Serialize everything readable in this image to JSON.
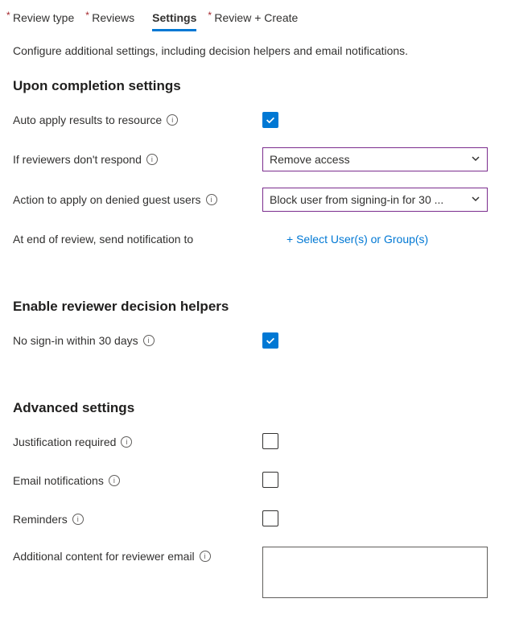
{
  "tabs": {
    "review_type": "Review type",
    "reviews": "Reviews",
    "settings": "Settings",
    "review_create": "Review + Create"
  },
  "intro": "Configure additional settings, including decision helpers and email notifications.",
  "sections": {
    "completion": {
      "title": "Upon completion settings",
      "auto_apply_label": "Auto apply results to resource",
      "no_respond_label": "If reviewers don't respond",
      "no_respond_value": "Remove access",
      "denied_guest_label": "Action to apply on denied guest users",
      "denied_guest_value": "Block user from signing-in for 30 ...",
      "notify_label": "At end of review, send notification to",
      "notify_action": "+ Select User(s) or Group(s)"
    },
    "decision_helpers": {
      "title": "Enable reviewer decision helpers",
      "no_signin_label": "No sign-in within 30 days"
    },
    "advanced": {
      "title": "Advanced settings",
      "justification_label": "Justification required",
      "email_label": "Email notifications",
      "reminders_label": "Reminders",
      "additional_content_label": "Additional content for reviewer email"
    }
  }
}
